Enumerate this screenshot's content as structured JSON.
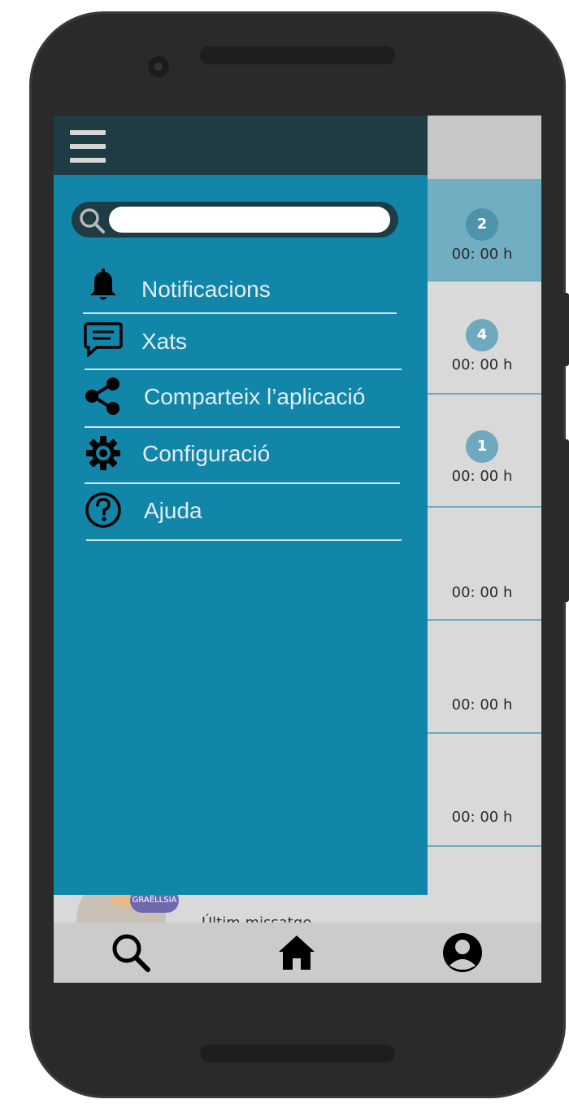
{
  "drawer": {
    "search": {
      "placeholder": "",
      "value": ""
    },
    "menu": [
      {
        "label": "Notificacions",
        "icon": "bell-icon"
      },
      {
        "label": "Xats",
        "icon": "chat-icon"
      },
      {
        "label": "Comparteix l’aplicació",
        "icon": "share-icon"
      },
      {
        "label": "Configuració",
        "icon": "gear-icon"
      },
      {
        "label": "Ajuda",
        "icon": "help-icon"
      }
    ]
  },
  "chats": [
    {
      "badge": "2",
      "time": "00: 00 h",
      "active": true
    },
    {
      "badge": "4",
      "time": "00: 00 h"
    },
    {
      "badge": "1",
      "time": "00: 00 h"
    },
    {
      "badge": "",
      "time": "00: 00 h"
    },
    {
      "badge": "",
      "time": "00: 00 h"
    },
    {
      "badge": "",
      "time": "00: 00 h"
    }
  ],
  "partial_row": {
    "avatar_tag": "GRAËLLSIA",
    "last_message": "Últim missatge"
  },
  "bottom_nav": [
    {
      "icon": "search-icon"
    },
    {
      "icon": "home-icon"
    },
    {
      "icon": "profile-icon"
    }
  ],
  "colors": {
    "drawer_bg": "#1286a8",
    "drawer_header": "#1f3b43",
    "active_row": "#72aec2",
    "badge": "#6fa9bd"
  }
}
